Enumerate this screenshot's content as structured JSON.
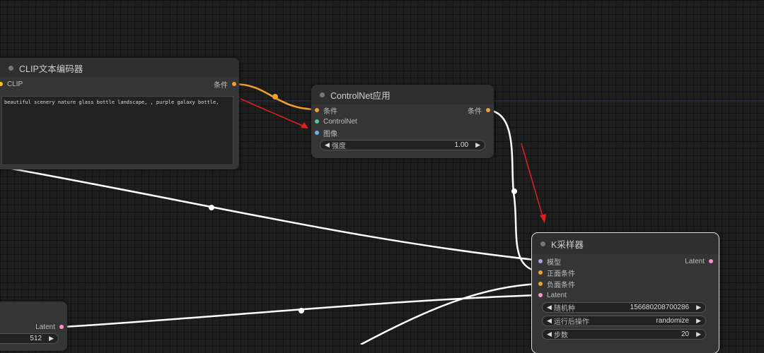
{
  "colors": {
    "conditioning": "#f0a030",
    "clip": "#f5c518",
    "controlnet": "#4ec9a0",
    "image": "#64b5f6",
    "model": "#b39ddb",
    "latent": "#ff8fd0",
    "wire_white": "#ffffff",
    "annotation_red": "#e02020"
  },
  "clip_node": {
    "title": "CLIP文本编码器",
    "input_clip": "CLIP",
    "output_conditioning": "条件",
    "prompt": "beautiful scenery nature glass bottle landscape, , purple galaxy bottle,"
  },
  "controlnet_node": {
    "title": "ControlNet应用",
    "input_conditioning": "条件",
    "input_controlnet": "ControlNet",
    "input_image": "图像",
    "output_conditioning": "条件",
    "strength_label": "强度",
    "strength_value": "1.00"
  },
  "ksampler_node": {
    "title": "K采样器",
    "input_model": "模型",
    "input_positive": "正面条件",
    "input_negative": "负面条件",
    "input_latent": "Latent",
    "output_latent": "Latent",
    "seed_label": "随机种",
    "seed_value": "156680208700286",
    "control_label": "运行后操作",
    "control_value": "randomize",
    "steps_label": "步数",
    "steps_value": "20"
  },
  "latent_node": {
    "output_latent": "Latent",
    "height_value": "512"
  }
}
